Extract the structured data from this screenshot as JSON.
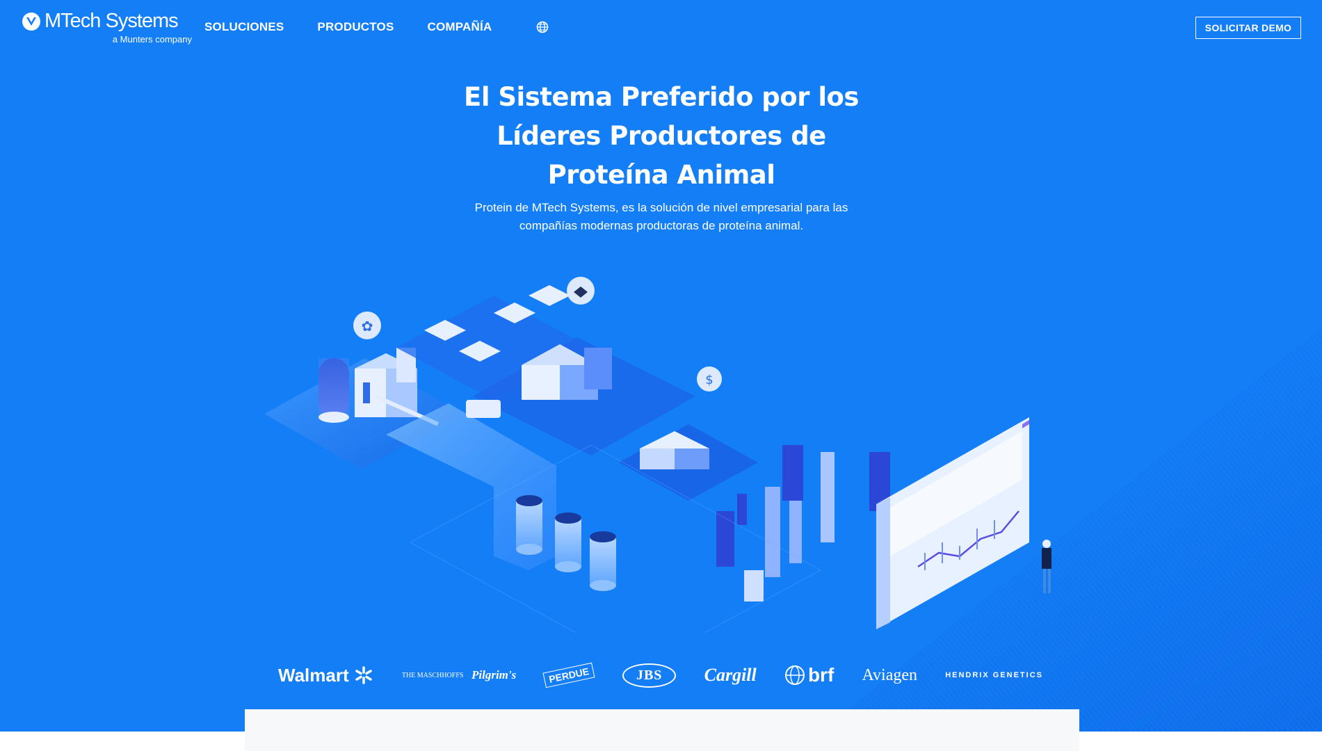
{
  "header": {
    "logo_name": "MTech Systems",
    "logo_tagline": "a Munters company",
    "nav": [
      "SOLUCIONES",
      "PRODUCTOS",
      "COMPAÑÍA"
    ],
    "language_icon": "globe-icon",
    "demo_label": "SOLICITAR DEMO"
  },
  "hero": {
    "title": "El Sistema Preferido por los Líderes Productores de Proteína Animal",
    "subtitle": "Protein de MTech Systems, es la solución de nivel empresarial para las compañías modernas productoras de proteína animal.",
    "illustration_icon": "isometric-protein-supply-chain-illustration"
  },
  "clients": {
    "walmart": "Walmart",
    "maschhoffs": "THE MASCHHOFFS",
    "pilgrims": "Pilgrim's",
    "perdue": "PERDUE",
    "jbs": "JBS",
    "cargill": "Cargill",
    "brf": "brf",
    "aviagen": "Aviagen",
    "hendrix": "HENDRIX GENETICS"
  },
  "colors": {
    "hero_background": "#137ef6",
    "accent_dark": "#1a5fd6",
    "card_background": "#f7f8fa"
  }
}
